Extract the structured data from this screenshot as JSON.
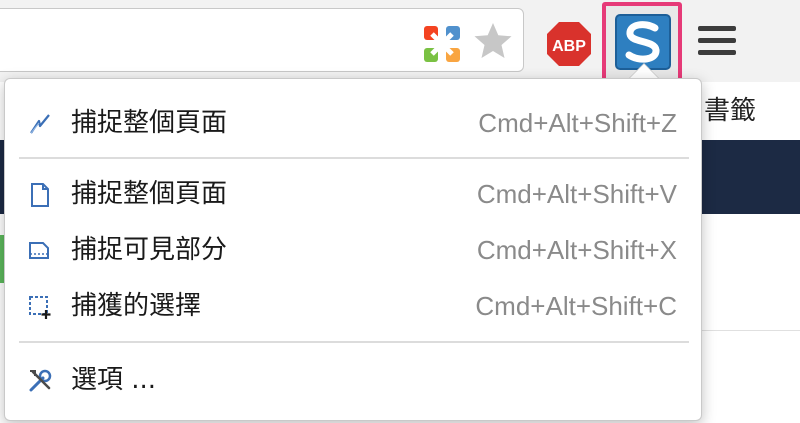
{
  "toolbar": {
    "extensions": [
      {
        "name": "joomla-extension",
        "icon": "joomla-icon"
      },
      {
        "name": "bookmark-star",
        "icon": "star-icon"
      },
      {
        "name": "adblock-plus",
        "icon": "abp-icon",
        "label": "ABP"
      },
      {
        "name": "snagit-extension",
        "icon": "snagit-icon"
      },
      {
        "name": "chrome-menu",
        "icon": "hamburger-icon"
      }
    ],
    "highlight_color": "#e63a78"
  },
  "bookmark_bar_peek": "書籤",
  "menu": {
    "items": [
      {
        "label": "捕捉整個頁面",
        "shortcut": "Cmd+Alt+Shift+Z",
        "icon": "lightning-icon"
      },
      {
        "label": "捕捉整個頁面",
        "shortcut": "Cmd+Alt+Shift+V",
        "icon": "page-icon"
      },
      {
        "label": "捕捉可見部分",
        "shortcut": "Cmd+Alt+Shift+X",
        "icon": "visible-area-icon"
      },
      {
        "label": "捕獲的選擇",
        "shortcut": "Cmd+Alt+Shift+C",
        "icon": "selection-icon"
      },
      {
        "label": "選項 ...",
        "shortcut": "",
        "icon": "tools-icon"
      }
    ]
  }
}
